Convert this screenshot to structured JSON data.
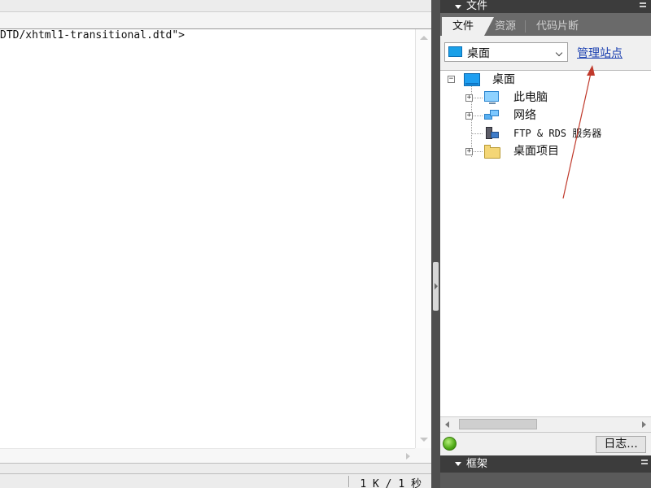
{
  "editor": {
    "code_line": "DTD/xhtml1-transitional.dtd\">",
    "status_text": "1 K / 1 秒"
  },
  "panel": {
    "title": "文件",
    "tabs": [
      {
        "label": "文件",
        "active": true
      },
      {
        "label": "资源",
        "active": false
      },
      {
        "label": "代码片断",
        "active": false
      }
    ],
    "site_select": {
      "value": "桌面",
      "icon": "desktop-icon"
    },
    "manage_link": "管理站点",
    "tree": [
      {
        "label": "桌面",
        "icon": "desktop-icon",
        "expander": "−"
      },
      {
        "label": "此电脑",
        "icon": "computer-icon",
        "expander": "+"
      },
      {
        "label": "网络",
        "icon": "network-icon",
        "expander": "+"
      },
      {
        "label": "FTP & RDS 服务器",
        "icon": "server-icon",
        "expander": ""
      },
      {
        "label": "桌面项目",
        "icon": "folder-icon",
        "expander": "+"
      }
    ],
    "log_button": "日志...",
    "status_indicator_color": "#4faa16",
    "annotation_arrow_color": "#c0392b"
  },
  "frame_panel": {
    "title": "框架"
  }
}
